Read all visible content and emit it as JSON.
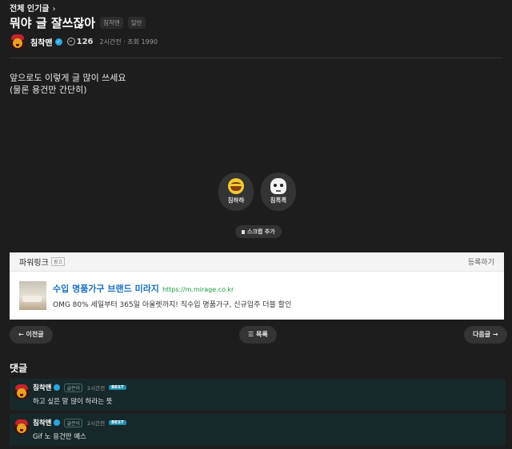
{
  "breadcrumb": {
    "label": "전체 인기글",
    "chevron": "›"
  },
  "post": {
    "title": "뭐야 글 잘쓰잖아",
    "tags": [
      "침착맨",
      "일반"
    ],
    "author": "침착맨",
    "level": "126",
    "meta": "2시간전 · 조회 1990",
    "body": [
      "앞으로도 이렇게 글 많이 쓰세요",
      "(물론 용건만 간단히)"
    ]
  },
  "reactions": [
    {
      "icon": "laughing-face-icon",
      "label": "침하하"
    },
    {
      "icon": "skull-icon",
      "label": "침흑흑"
    }
  ],
  "scrap_label": "스크랩 추가",
  "ad": {
    "title": "파워링크",
    "badge": "광고",
    "more": "등록하기",
    "headline": "수입 명품가구 브랜드 미라지",
    "url": "https://m.mirage.co.kr",
    "desc": "OMG 80% 세일부터 365일 아울렛까지! 직수입 명품가구, 신규입주 더블 할인"
  },
  "nav": {
    "prev": "← 이전글",
    "list": "☰ 목록",
    "next": "다음글 →"
  },
  "comments": {
    "title": "댓글",
    "items": [
      {
        "author": "침착맨",
        "role": "글쓴이",
        "time": "2시간전",
        "badge": "BEST",
        "text": "하고 싶은 말 많이 하라는 뜻"
      },
      {
        "author": "침착맨",
        "role": "글쓴이",
        "time": "2시간전",
        "badge": "BEST",
        "text": "Gif 노 용건만 예스"
      }
    ]
  }
}
